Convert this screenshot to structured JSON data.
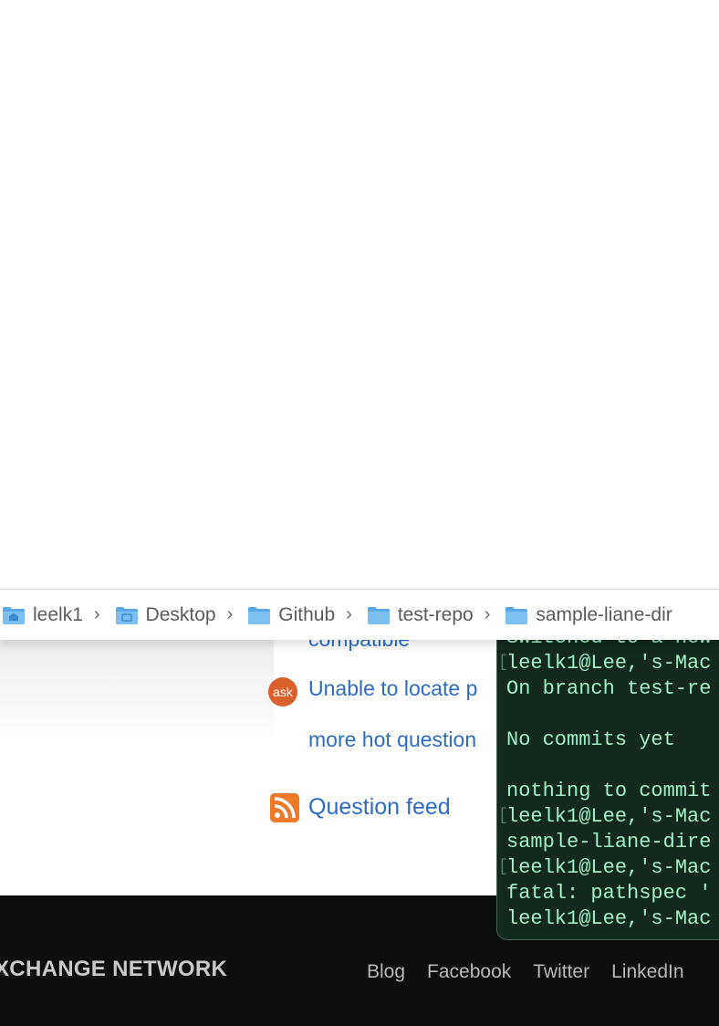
{
  "finder": {
    "path": [
      {
        "label": "leelk1",
        "icon": "home-folder-icon"
      },
      {
        "label": "Desktop",
        "icon": "desktop-folder-icon"
      },
      {
        "label": "Github",
        "icon": "folder-icon"
      },
      {
        "label": "test-repo",
        "icon": "folder-icon"
      },
      {
        "label": "sample-liane-dir",
        "icon": "folder-icon"
      }
    ]
  },
  "page": {
    "hot_questions": [
      {
        "text": "compatible"
      },
      {
        "text": "Unable to locate p",
        "badge": "ask"
      }
    ],
    "more_hot_questions": "more hot question",
    "question_feed": "Question feed"
  },
  "footer": {
    "network_title": "XCHANGE NETWORK",
    "links": [
      "Blog",
      "Facebook",
      "Twitter",
      "LinkedIn"
    ]
  },
  "terminal": {
    "lines": [
      {
        "text": "Switched to a new",
        "bracket": false
      },
      {
        "text": "leelk1@Lee,'s-Mac",
        "bracket": true
      },
      {
        "text": "On branch test-re",
        "bracket": false
      },
      {
        "text": "",
        "bracket": false
      },
      {
        "text": "No commits yet",
        "bracket": false
      },
      {
        "text": "",
        "bracket": false
      },
      {
        "text": "nothing to commit",
        "bracket": false
      },
      {
        "text": "leelk1@Lee,'s-Mac",
        "bracket": true
      },
      {
        "text": "sample-liane-dire",
        "bracket": false
      },
      {
        "text": "leelk1@Lee,'s-Mac",
        "bracket": true
      },
      {
        "text": "fatal: pathspec '",
        "bracket": false
      },
      {
        "text": "leelk1@Lee,'s-Mac",
        "bracket": false
      }
    ]
  },
  "colors": {
    "link": "#2f6bc2",
    "terminal_bg": "#13291e",
    "terminal_text": "#9ff0c6",
    "footer_bg": "#0d0e10"
  }
}
